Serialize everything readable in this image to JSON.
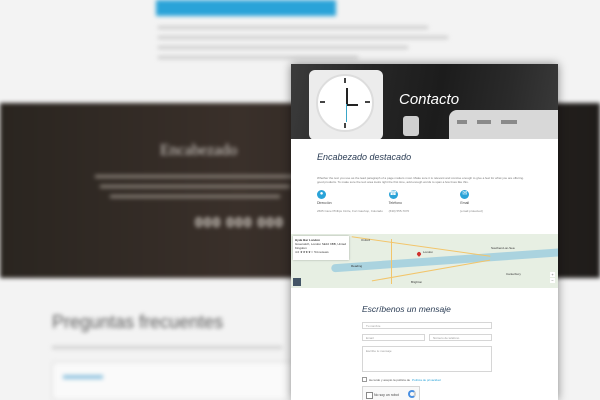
{
  "hero": {
    "title": "Contacto"
  },
  "content": {
    "heading": "Encabezado destacado",
    "description_lines": [
      "Whether the text you use as the lead paragraph of a page matters most. Make sure it is relevant and concise enough to give a feel for what you are offering.",
      "good products. To make sure the text area looks right the first time, add enough words to span a few lines like this."
    ]
  },
  "info": [
    {
      "icon": "location-icon",
      "label": "Dirección",
      "value": "2605 Cane Phillips Circle, Fort Gauhop, Colorado"
    },
    {
      "icon": "phone-icon",
      "label": "Teléfono",
      "value": "(630) 555-7070"
    },
    {
      "icon": "email-icon",
      "label": "Email",
      "value": "[email protected]"
    }
  ],
  "map": {
    "place_title": "Hyde Bar London",
    "place_lines": [
      "Greenwich, London SE10 9BB, United Kingdom",
      "4.0 ★★★★☆  54 reviews"
    ],
    "labels": [
      "Oxford",
      "London",
      "Reading",
      "Southend-on-Sea",
      "Canterbury",
      "Brighton"
    ]
  },
  "form": {
    "title": "Escríbenos un mensaje",
    "name_placeholder": "Tu nombre",
    "email_placeholder": "Email",
    "phone_placeholder": "Número de teléfono",
    "message_placeholder": "Escribe tu mensaje",
    "privacy_prefix": "He leído y acepto la política de",
    "privacy_link": "Política de privacidad",
    "captcha_label": "No soy un robot"
  },
  "background": {
    "hero_title": "Encabezado",
    "hero_number": "000 000 000",
    "faq_title": "Preguntas frecuentes"
  }
}
